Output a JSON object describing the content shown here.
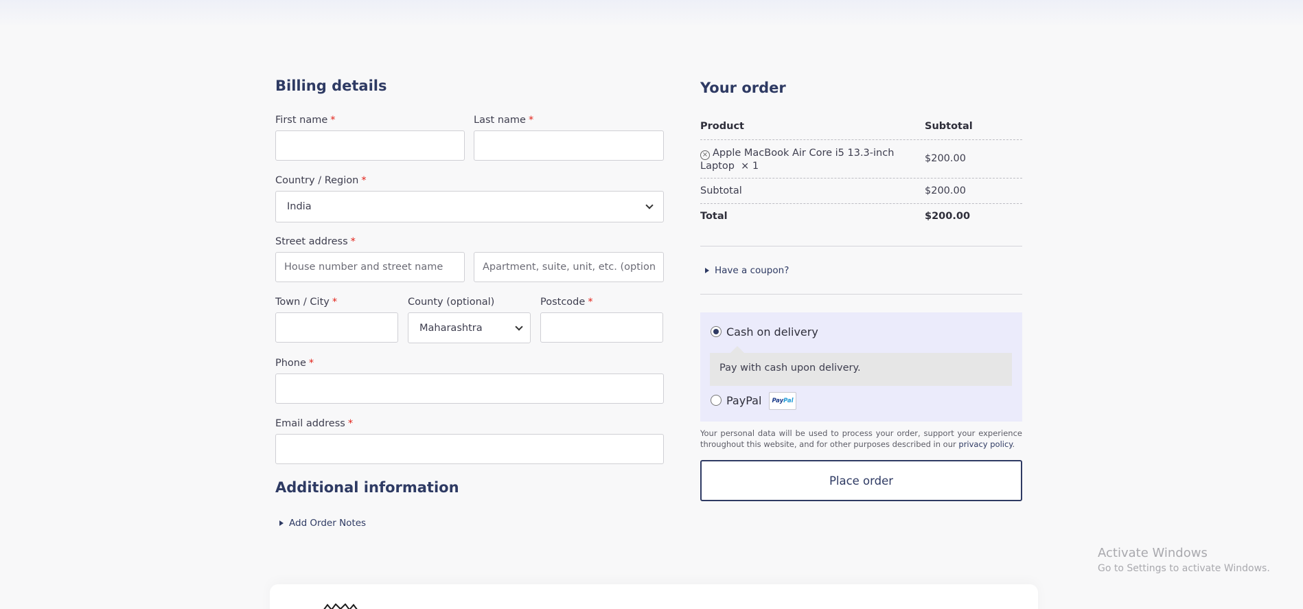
{
  "billing": {
    "title": "Billing details",
    "first_name": {
      "label": "First name",
      "required": "*",
      "value": ""
    },
    "last_name": {
      "label": "Last name",
      "required": "*",
      "value": ""
    },
    "country": {
      "label": "Country / Region",
      "required": "*",
      "value": "India"
    },
    "street": {
      "label": "Street address",
      "required": "*",
      "placeholder1": "House number and street name",
      "placeholder2": "Apartment, suite, unit, etc. (optional)"
    },
    "town": {
      "label": "Town / City",
      "required": "*",
      "value": ""
    },
    "county": {
      "label": "County (optional)",
      "value": "Maharashtra"
    },
    "postcode": {
      "label": "Postcode",
      "required": "*",
      "value": ""
    },
    "phone": {
      "label": "Phone",
      "required": "*",
      "value": ""
    },
    "email": {
      "label": "Email address",
      "required": "*",
      "value": ""
    }
  },
  "additional": {
    "title": "Additional information",
    "notes_toggle": "Add Order Notes"
  },
  "order": {
    "title": "Your order",
    "columns": {
      "product": "Product",
      "subtotal": "Subtotal"
    },
    "item": {
      "name_line1": "Apple MacBook Air Core i5 13.3-inch",
      "name_line2": "Laptop",
      "qty": "× 1",
      "price": "$200.00",
      "remove_icon": "ⓧ"
    },
    "subtotal": {
      "label": "Subtotal",
      "value": "$200.00"
    },
    "total": {
      "label": "Total",
      "value": "$200.00"
    },
    "coupon_toggle": "Have a coupon?"
  },
  "payment": {
    "options": [
      {
        "label": "Cash on delivery",
        "checked": true,
        "description": "Pay with cash upon delivery."
      },
      {
        "label": "PayPal",
        "checked": false,
        "badge_pay": "Pay",
        "badge_pal": "Pal"
      }
    ]
  },
  "privacy": {
    "text": "Your personal data will be used to process your order, support your experience throughout this website, and for other purposes described in our ",
    "link": "privacy policy",
    "end": "."
  },
  "place_order_label": "Place order",
  "watermark": {
    "line1": "Activate Windows",
    "line2": "Go to Settings to activate Windows."
  },
  "colors": {
    "accent": "#2e3a63",
    "required": "#e2231a",
    "payment_bg": "#ebebfb"
  }
}
